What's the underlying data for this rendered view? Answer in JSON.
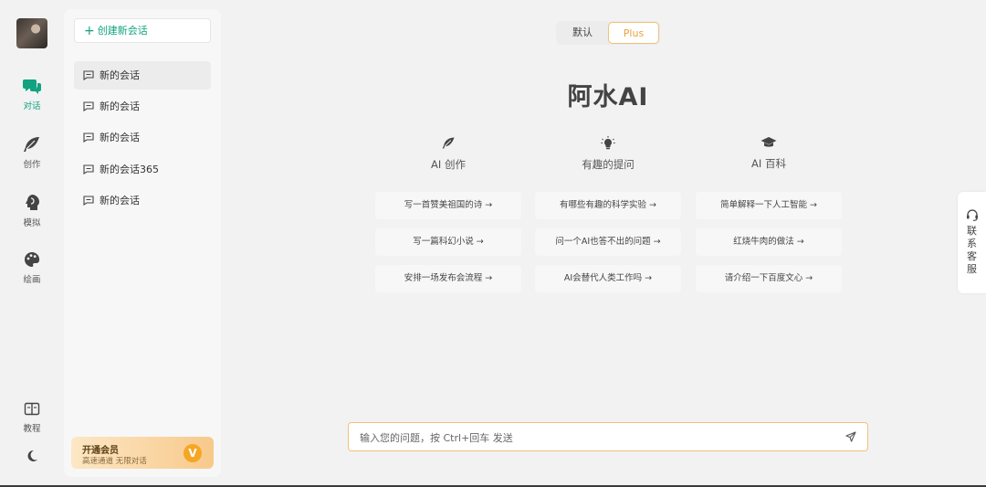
{
  "rail": {
    "items": [
      {
        "label": "对话",
        "icon": "chat-bubbles-icon",
        "active": true
      },
      {
        "label": "创作",
        "icon": "feather-icon",
        "active": false
      },
      {
        "label": "模拟",
        "icon": "head-profile-icon",
        "active": false
      },
      {
        "label": "绘画",
        "icon": "palette-icon",
        "active": false
      }
    ],
    "bottom": {
      "tutorial_label": "教程",
      "tutorial_icon": "book-icon",
      "theme_icon": "moon-icon"
    }
  },
  "sidebar": {
    "new_chat_label": "创建新会话",
    "conversations": [
      {
        "label": "新的会话",
        "active": true
      },
      {
        "label": "新的会话",
        "active": false
      },
      {
        "label": "新的会话",
        "active": false
      },
      {
        "label": "新的会话365",
        "active": false
      },
      {
        "label": "新的会话",
        "active": false
      }
    ],
    "vip": {
      "title": "开通会员",
      "subtitle": "高速通道 无限对话",
      "badge": "V"
    }
  },
  "mode": {
    "default_label": "默认",
    "plus_label": "Plus",
    "selected": "Plus"
  },
  "main": {
    "title": "阿水AI",
    "columns": [
      {
        "label": "AI 创作",
        "icon": "feather-icon",
        "suggestions": [
          "写一首赞美祖国的诗 →",
          "写一篇科幻小说 →",
          "安排一场发布会流程 →"
        ]
      },
      {
        "label": "有趣的提问",
        "icon": "lightbulb-icon",
        "suggestions": [
          "有哪些有趣的科学实验 →",
          "问一个AI也答不出的问题 →",
          "AI会替代人类工作吗 →"
        ]
      },
      {
        "label": "AI 百科",
        "icon": "graduation-cap-icon",
        "suggestions": [
          "简单解释一下人工智能 →",
          "红烧牛肉的做法 →",
          "请介绍一下百度文心 →"
        ]
      }
    ]
  },
  "contact": {
    "label": "联系客服",
    "icon": "headset-icon"
  },
  "input": {
    "placeholder": "输入您的问题，按 Ctrl+回车 发送",
    "send_icon": "send-icon"
  },
  "colors": {
    "accent": "#11a37f",
    "plus": "#e8a33c",
    "vip_badge": "#f5a623"
  }
}
